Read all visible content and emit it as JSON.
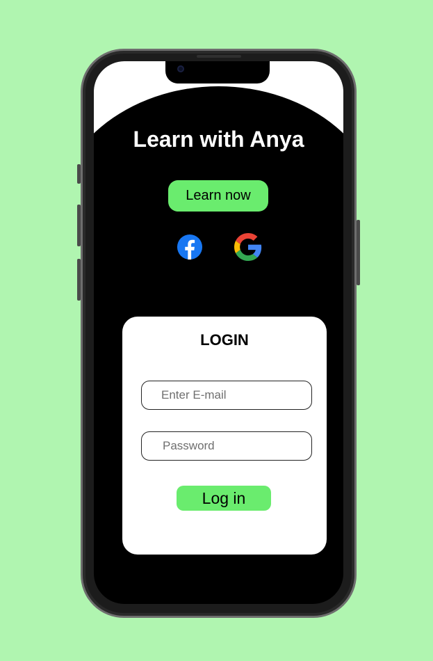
{
  "app": {
    "title": "Learn with Anya",
    "cta_label": "Learn now"
  },
  "social": {
    "facebook_icon": "facebook-icon",
    "google_icon": "google-icon",
    "colors": {
      "facebook": "#1877F2",
      "google_blue": "#4285F4",
      "google_red": "#EA4335",
      "google_yellow": "#FBBC05",
      "google_green": "#34A853"
    }
  },
  "login": {
    "title": "LOGIN",
    "email_placeholder": "Enter E-mail",
    "email_value": "",
    "password_placeholder": "Password",
    "password_value": "",
    "submit_label": "Log in"
  },
  "theme": {
    "background": "#B0F5B0",
    "accent": "#6AEC6E",
    "screen": "#000000",
    "card": "#FFFFFF"
  }
}
